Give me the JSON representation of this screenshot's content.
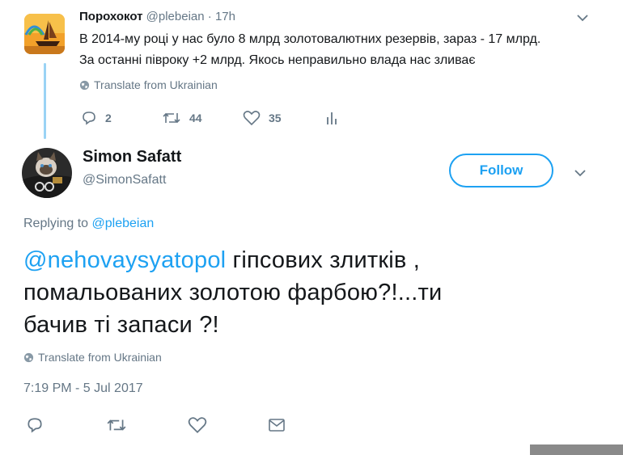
{
  "parent_tweet": {
    "display_name": "Порохокот",
    "handle": "@plebeian",
    "separator": "·",
    "time": "17h",
    "text_line1": "В 2014-му році у нас було 8 млрд золотовалютних резервів, зараз - 17 млрд.",
    "text_line2": "За останні півроку +2 млрд. Якось неправильно влада нас зливає",
    "translate": "Translate from Ukrainian",
    "replies": "2",
    "retweets": "44",
    "likes": "35"
  },
  "main_tweet": {
    "display_name": "Simon Safatt",
    "handle": "@SimonSafatt",
    "follow_label": "Follow",
    "replying_prefix": "Replying to",
    "replying_handle": "@plebeian",
    "mention": "@nehovaysyatopol",
    "text_rest": " гіпсових злитків ,",
    "text_line2": "помальованих золотою фарбою?!...ти",
    "text_line3": "бачив ті запаси ?!",
    "translate": "Translate from Ukrainian",
    "timestamp": "7:19 PM - 5 Jul 2017"
  },
  "icons": [
    "globe-icon",
    "chevron-down-icon",
    "reply-icon",
    "retweet-icon",
    "like-icon",
    "analytics-icon",
    "message-icon"
  ],
  "colors": {
    "accent": "#1da1f2",
    "muted": "#657786",
    "thread": "#9ad3f5",
    "text": "#14171a"
  }
}
